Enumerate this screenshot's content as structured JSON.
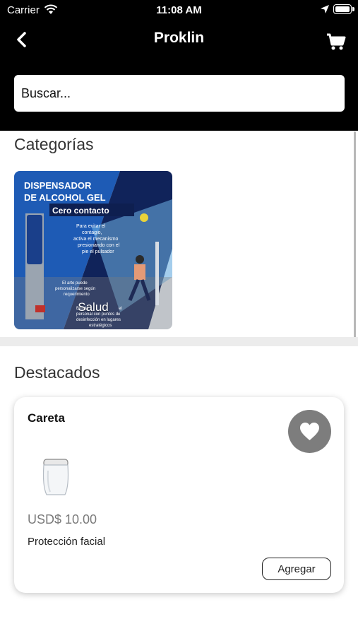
{
  "status_bar": {
    "carrier": "Carrier",
    "time": "11:08 AM",
    "icons": [
      "wifi-icon",
      "location-arrow-icon",
      "battery-icon"
    ]
  },
  "header": {
    "title": "Proklin",
    "back_icon": "chevron-left-icon",
    "cart_icon": "shopping-cart-icon",
    "background": "#000000"
  },
  "search": {
    "placeholder": "Buscar...",
    "value": ""
  },
  "categories": {
    "title": "Categorías",
    "items": [
      {
        "label": "Salud",
        "image": {
          "headline_1": "DISPENSADOR",
          "headline_2": "DE ALCOHOL GEL",
          "banner": "Cero contacto",
          "text_1": "Para evitar el",
          "text_2": "contagio,",
          "text_3": "activa el mecanismo",
          "text_4": "presionando con el",
          "text_5": "pie el pulsador",
          "note_1": "El arte puede",
          "note_2": "personalizarse según",
          "note_3": "requerimiento",
          "bottom_1": "Brinda",
          "bottom_2": "el",
          "bottom_3": "personal con puntos de",
          "bottom_4": "desinfección en lugares",
          "bottom_5": "estratégicos"
        }
      }
    ]
  },
  "featured": {
    "title": "Destacados",
    "products": [
      {
        "name": "Careta",
        "price": "USD$ 10.00",
        "description": "Protección facial",
        "add_label": "Agregar",
        "favorite_icon": "heart-icon"
      }
    ]
  },
  "colors": {
    "header_bg": "#000000",
    "fav_button": "#7d7d7d",
    "poster_blue": "#1e5bb5",
    "poster_navy": "#10235a"
  }
}
